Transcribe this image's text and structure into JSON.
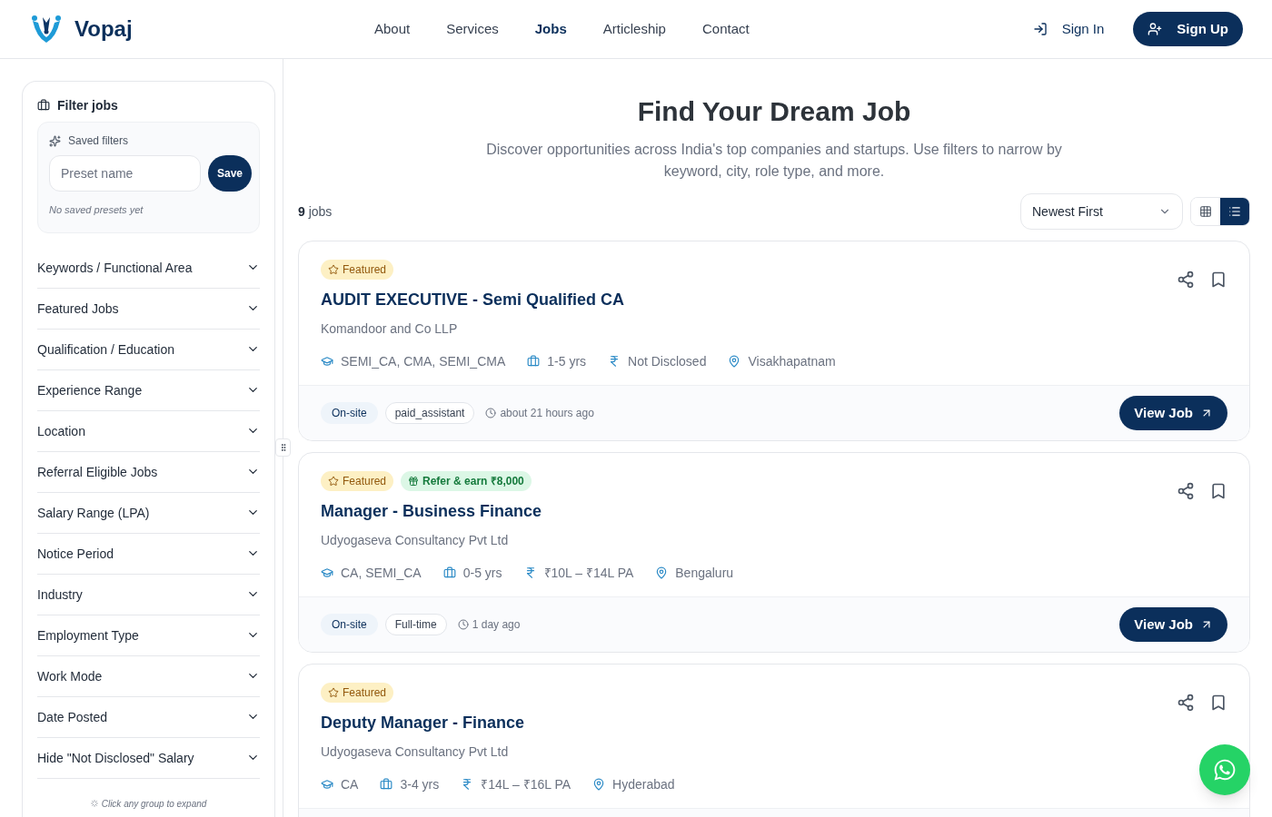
{
  "brand": {
    "name": "Vopaj"
  },
  "nav": [
    {
      "label": "About",
      "selected": false
    },
    {
      "label": "Services",
      "selected": false
    },
    {
      "label": "Jobs",
      "selected": true
    },
    {
      "label": "Articleship",
      "selected": false
    },
    {
      "label": "Contact",
      "selected": false
    }
  ],
  "auth": {
    "sign_in": "Sign In",
    "sign_up": "Sign Up"
  },
  "sidebar": {
    "title": "Filter jobs",
    "saved_filters": {
      "title": "Saved filters",
      "placeholder": "Preset name",
      "save": "Save",
      "empty": "No saved presets yet"
    },
    "groups": [
      {
        "label": "Keywords / Functional Area",
        "expanded": false
      },
      {
        "label": "Featured Jobs",
        "expanded": false
      },
      {
        "label": "Qualification / Education",
        "expanded": false
      },
      {
        "label": "Experience Range",
        "expanded": false
      },
      {
        "label": "Location",
        "expanded": false
      },
      {
        "label": "Referral Eligible Jobs",
        "expanded": false
      },
      {
        "label": "Salary Range (LPA)",
        "expanded": false
      },
      {
        "label": "Notice Period",
        "expanded": false
      },
      {
        "label": "Industry",
        "expanded": false
      },
      {
        "label": "Employment Type",
        "expanded": false
      },
      {
        "label": "Work Mode",
        "expanded": false
      },
      {
        "label": "Date Posted",
        "expanded": false
      },
      {
        "label": "Hide \"Not Disclosed\" Salary",
        "expanded": false
      }
    ],
    "hint": "Click any group to expand"
  },
  "hero": {
    "title": "Find Your Dream Job",
    "subtitle": "Discover opportunities across India's top companies and startups. Use filters to narrow by keyword, city, role type, and more."
  },
  "results": {
    "count": "**9** jobs",
    "sort": "Newest First",
    "views": [
      {
        "kind": "grid",
        "selected": false
      },
      {
        "kind": "list",
        "selected": true
      }
    ]
  },
  "jobs": [
    {
      "badges": [
        {
          "kind": "featured",
          "label": "Featured"
        }
      ],
      "title": "AUDIT EXECUTIVE - Semi Qualified CA",
      "company": "Komandoor and Co LLP",
      "meta": [
        {
          "kind": "qualification",
          "text": "SEMI_CA, CMA, SEMI_CMA"
        },
        {
          "kind": "experience",
          "text": "1-5 yrs"
        },
        {
          "kind": "salary",
          "text": "Not Disclosed"
        },
        {
          "kind": "location",
          "text": "Visakhapatnam"
        }
      ],
      "tags": [
        {
          "kind": "mode",
          "label": "On-site"
        },
        {
          "kind": "type",
          "label": "paid_assistant"
        }
      ],
      "posted": "about 21 hours ago",
      "action": "View Job"
    },
    {
      "badges": [
        {
          "kind": "featured",
          "label": "Featured"
        },
        {
          "kind": "referral",
          "label": "Refer & earn ₹8,000"
        }
      ],
      "title": "Manager - Business Finance",
      "company": "Udyogaseva Consultancy Pvt Ltd",
      "meta": [
        {
          "kind": "qualification",
          "text": "CA, SEMI_CA"
        },
        {
          "kind": "experience",
          "text": "0-5 yrs"
        },
        {
          "kind": "salary",
          "text": "₹10L – ₹14L PA"
        },
        {
          "kind": "location",
          "text": "Bengaluru"
        }
      ],
      "tags": [
        {
          "kind": "mode",
          "label": "On-site"
        },
        {
          "kind": "type",
          "label": "Full-time"
        }
      ],
      "posted": "1 day ago",
      "action": "View Job"
    },
    {
      "badges": [
        {
          "kind": "featured",
          "label": "Featured"
        }
      ],
      "title": "Deputy Manager - Finance",
      "company": "Udyogaseva Consultancy Pvt Ltd",
      "meta": [
        {
          "kind": "qualification",
          "text": "CA"
        },
        {
          "kind": "experience",
          "text": "3-4 yrs"
        },
        {
          "kind": "salary",
          "text": "₹14L – ₹16L PA"
        },
        {
          "kind": "location",
          "text": "Hyderabad"
        }
      ]
    }
  ]
}
